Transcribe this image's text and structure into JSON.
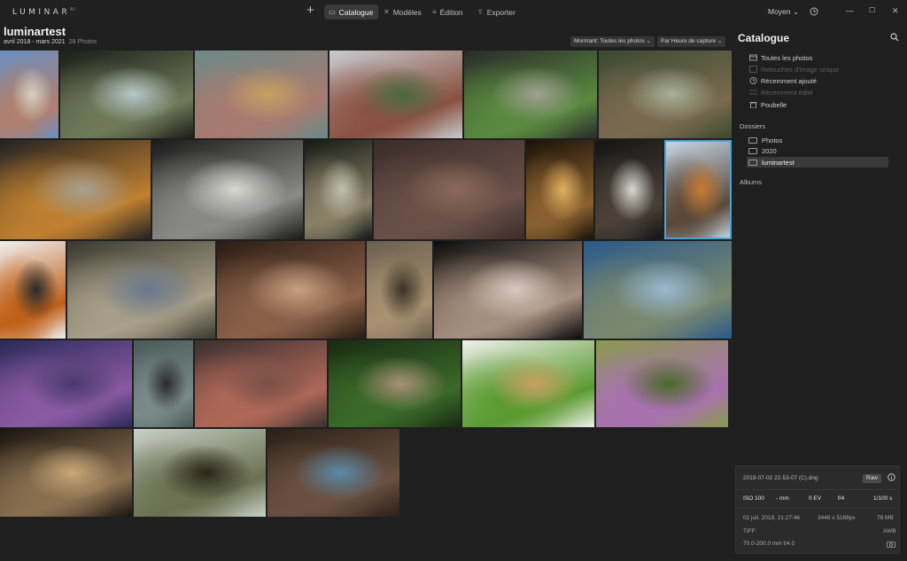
{
  "app": {
    "logo": "LUMINAR",
    "logo_sup": "AI"
  },
  "nav": {
    "add_icon": "plus-icon",
    "tabs": [
      {
        "label": "Catalogue",
        "icon": "folder-icon",
        "active": true
      },
      {
        "label": "Modèles",
        "icon": "wand-icon",
        "active": false
      },
      {
        "label": "Édition",
        "icon": "sliders-icon",
        "active": false
      },
      {
        "label": "Exporter",
        "icon": "export-icon",
        "active": false
      }
    ],
    "size_select": "Moyen",
    "size_chevron": "⌄"
  },
  "window": {
    "minimize": "—",
    "maximize": "☐",
    "close": "✕"
  },
  "header": {
    "title": "luminartest",
    "date_range": "avril 2018 - mars 2021",
    "count": "28 Photos",
    "filter": "Montrant: Toutes les photos ⌄",
    "sort": "Par Heure de capture ⌄"
  },
  "photos": [
    {
      "subject": "half-timbered houses",
      "colors": [
        "#6a8fc0",
        "#b08070",
        "#d8d0c0"
      ]
    },
    {
      "subject": "tree in park",
      "colors": [
        "#1a1e18",
        "#6f7a5a",
        "#b8c8c8"
      ]
    },
    {
      "subject": "bee on flowers",
      "colors": [
        "#6a8a88",
        "#a87a70",
        "#c8a060"
      ]
    },
    {
      "subject": "old town river",
      "colors": [
        "#c8ccd0",
        "#8a5040",
        "#4a6a40"
      ]
    },
    {
      "subject": "pergola garden",
      "colors": [
        "#2a2a2a",
        "#5a8a40",
        "#a0a090"
      ]
    },
    {
      "subject": "bonsai tree",
      "colors": [
        "#3a4a30",
        "#7a6a50",
        "#a8b098"
      ]
    },
    {
      "subject": "butterfly wing closeup",
      "colors": [
        "#222",
        "#c08030",
        "#a8a090"
      ]
    },
    {
      "subject": "damselfly",
      "colors": [
        "#1a1a1a",
        "#8a8a88",
        "#d8d8d0"
      ]
    },
    {
      "subject": "damselfly portrait",
      "colors": [
        "#141a14",
        "#8a8068",
        "#c0c0b0"
      ]
    },
    {
      "subject": "dome ceiling",
      "colors": [
        "#3a2c28",
        "#6a5048",
        "#8a6a5a"
      ]
    },
    {
      "subject": "chandelier",
      "colors": [
        "#1a1208",
        "#8a6030",
        "#e0b060"
      ]
    },
    {
      "subject": "oval windows",
      "colors": [
        "#141414",
        "#4a4038",
        "#d8d8d0"
      ]
    },
    {
      "subject": "fly closeup",
      "colors": [
        "#c8d8e8",
        "#5a4838",
        "#c87a30"
      ]
    },
    {
      "subject": "hornet",
      "colors": [
        "#f0f0f0",
        "#c06018",
        "#2a2a2a"
      ]
    },
    {
      "subject": "cathedral vault",
      "colors": [
        "#3a3830",
        "#a8a088",
        "#6a7890"
      ]
    },
    {
      "subject": "arches courtyard",
      "colors": [
        "#2a1c14",
        "#8a6048",
        "#c8a080"
      ]
    },
    {
      "subject": "lioness",
      "colors": [
        "#6a6050",
        "#a89070",
        "#3a3228"
      ]
    },
    {
      "subject": "framed painting",
      "colors": [
        "#0c0c0c",
        "#a89080",
        "#d8c8c0"
      ]
    },
    {
      "subject": "sea turtle",
      "colors": [
        "#2a5a8a",
        "#7a8870",
        "#9ab8d0"
      ]
    },
    {
      "subject": "cuttlefish",
      "colors": [
        "#2a2a5a",
        "#8a5aa0",
        "#4a3a70"
      ]
    },
    {
      "subject": "statue",
      "colors": [
        "#4a5a58",
        "#7a8a88",
        "#2a2a2a"
      ]
    },
    {
      "subject": "scorpionfish",
      "colors": [
        "#3a3030",
        "#b06858",
        "#7a5048"
      ]
    },
    {
      "subject": "butterfly on leaf",
      "colors": [
        "#1a2a14",
        "#3a6a28",
        "#a89078"
      ]
    },
    {
      "subject": "tree frog white",
      "colors": [
        "#f0f0ec",
        "#5a9a30",
        "#c8a060"
      ]
    },
    {
      "subject": "tree frog flowers",
      "colors": [
        "#8a9a50",
        "#a870b0",
        "#4a6a28"
      ]
    },
    {
      "subject": "skulls",
      "colors": [
        "#1a1410",
        "#8a7050",
        "#c8a878"
      ]
    },
    {
      "subject": "beetle on buds",
      "colors": [
        "#c8d0c8",
        "#6a7050",
        "#2a2418"
      ]
    },
    {
      "subject": "spider",
      "colors": [
        "#2a2018",
        "#6a5040",
        "#5a8aa8"
      ]
    }
  ],
  "catalogue": {
    "title": "Catalogue",
    "search_icon": "search-icon",
    "library": [
      {
        "label": "Toutes les photos",
        "icon": "photos-icon",
        "dim": false
      },
      {
        "label": "Retouches d'image unique",
        "icon": "single-edit-icon",
        "dim": true
      },
      {
        "label": "Récemment ajouté",
        "icon": "clock-icon",
        "dim": false
      },
      {
        "label": "Récemment édité",
        "icon": "sliders-icon",
        "dim": true
      },
      {
        "label": "Poubelle",
        "icon": "trash-icon",
        "dim": false
      }
    ],
    "folders_label": "Dossiers",
    "folders": [
      {
        "label": "Photos",
        "active": false
      },
      {
        "label": "2020",
        "active": false
      },
      {
        "label": "luminartest",
        "active": true
      }
    ],
    "albums_label": "Albums"
  },
  "info": {
    "filename": "2019-07-02 22-53-07 (C).dng",
    "format_badge": "Raw",
    "iso": "ISO 100",
    "focal": "- mm",
    "ev": "0 EV",
    "aperture": "f/4",
    "shutter": "1/100 s",
    "datetime": "02 juil. 2019, 21:27:46",
    "dimensions": "3448 x 5168px",
    "filesize": "78 MB",
    "type": "TIFF",
    "wb": "AWB",
    "lens": "70.0-200.0 mm f/4.0"
  }
}
